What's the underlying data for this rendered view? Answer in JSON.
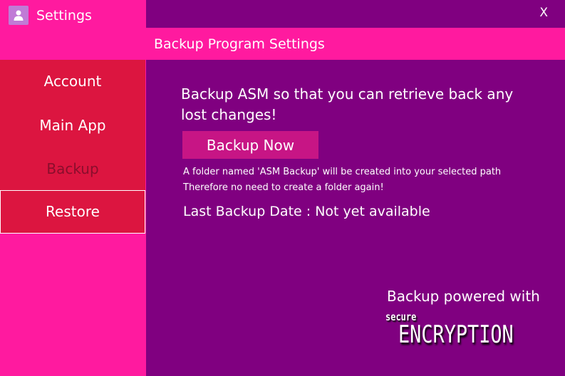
{
  "app": {
    "title": "Settings",
    "icon": "user-icon"
  },
  "sidebar": {
    "items": [
      {
        "label": "Account"
      },
      {
        "label": "Main App"
      },
      {
        "label": "Backup"
      },
      {
        "label": "Restore"
      }
    ]
  },
  "window": {
    "close_label": "X"
  },
  "main": {
    "title": "Backup Program Settings",
    "intro_text": "Backup ASM so that you can retrieve back any lost changes!",
    "backup_button_label": "Backup Now",
    "note_line_1": "A folder named 'ASM Backup' will be created into your selected path",
    "note_line_2": "Therefore no need to create a folder again!",
    "last_backup_text": "Last Backup Date : Not yet available"
  },
  "footer": {
    "powered_text": "Backup powered with",
    "brand_small": "secure",
    "brand_big": "ENCRYPTION"
  },
  "colors": {
    "pink": "#ff1a9f",
    "purple": "#800080",
    "nav_red": "#dc1540",
    "button": "#c71585"
  }
}
